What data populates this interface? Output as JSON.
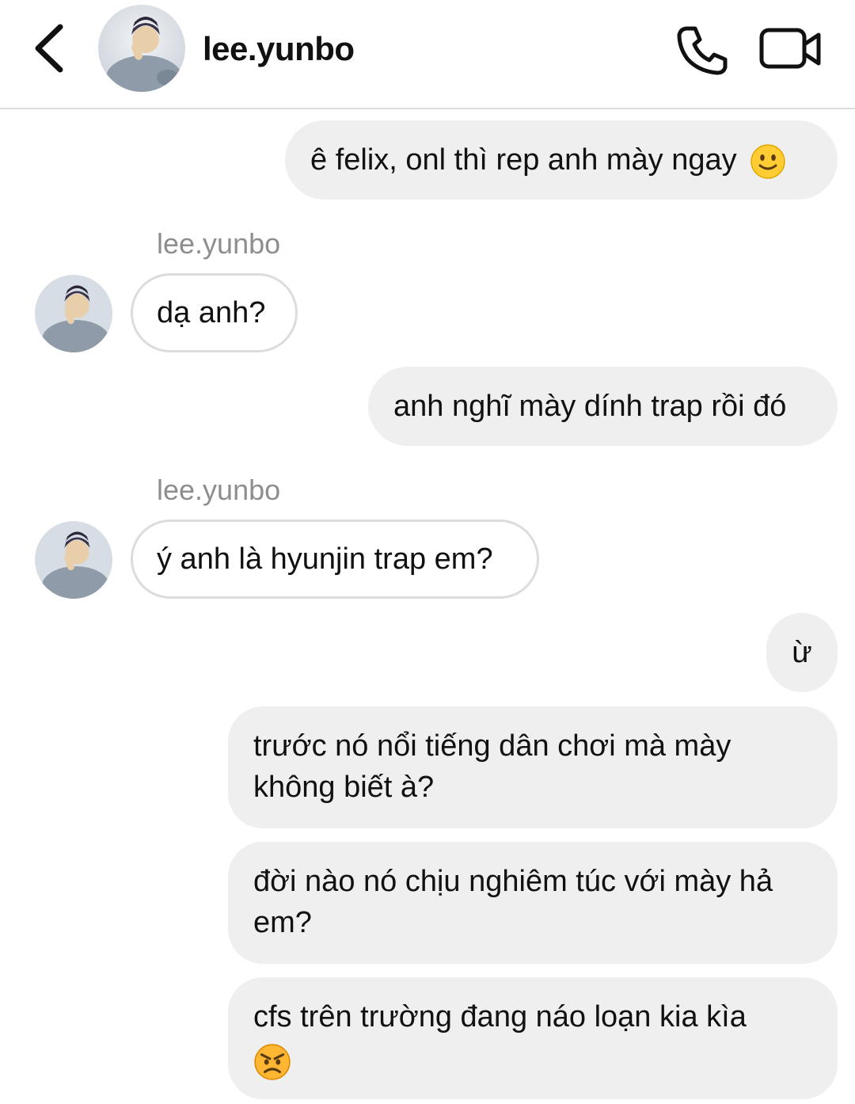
{
  "header": {
    "contact_name": "lee.yunbo",
    "icons": [
      "back-chevron-icon",
      "avatar",
      "phone-icon",
      "video-camera-icon"
    ]
  },
  "messages": [
    {
      "direction": "outgoing",
      "text": "ê felix, onl thì rep anh mày ngay",
      "emoji": "slightly-smiling-face-emoji"
    },
    {
      "direction": "incoming",
      "sender": "lee.yunbo",
      "text": "dạ anh?"
    },
    {
      "direction": "outgoing",
      "text": "anh nghĩ mày dính trap rồi đó"
    },
    {
      "direction": "incoming",
      "sender": "lee.yunbo",
      "text": "ý anh là hyunjin trap em?"
    },
    {
      "direction": "outgoing",
      "text": "ừ"
    },
    {
      "direction": "outgoing",
      "line1": "trước nó nổi tiếng dân chơi mà mày",
      "line2": "không biết à?"
    },
    {
      "direction": "outgoing",
      "line1": "đời nào nó chịu nghiêm túc với mày hả",
      "line2": "em?"
    },
    {
      "direction": "outgoing",
      "line1": "cfs trên trường đang náo loạn kia kìa",
      "emoji": "angry-face-emoji"
    }
  ],
  "colors": {
    "outgoing_bubble": "#efefef",
    "incoming_border": "#dcdcdc",
    "sender_label": "#8e8e8e",
    "text": "#111111"
  }
}
